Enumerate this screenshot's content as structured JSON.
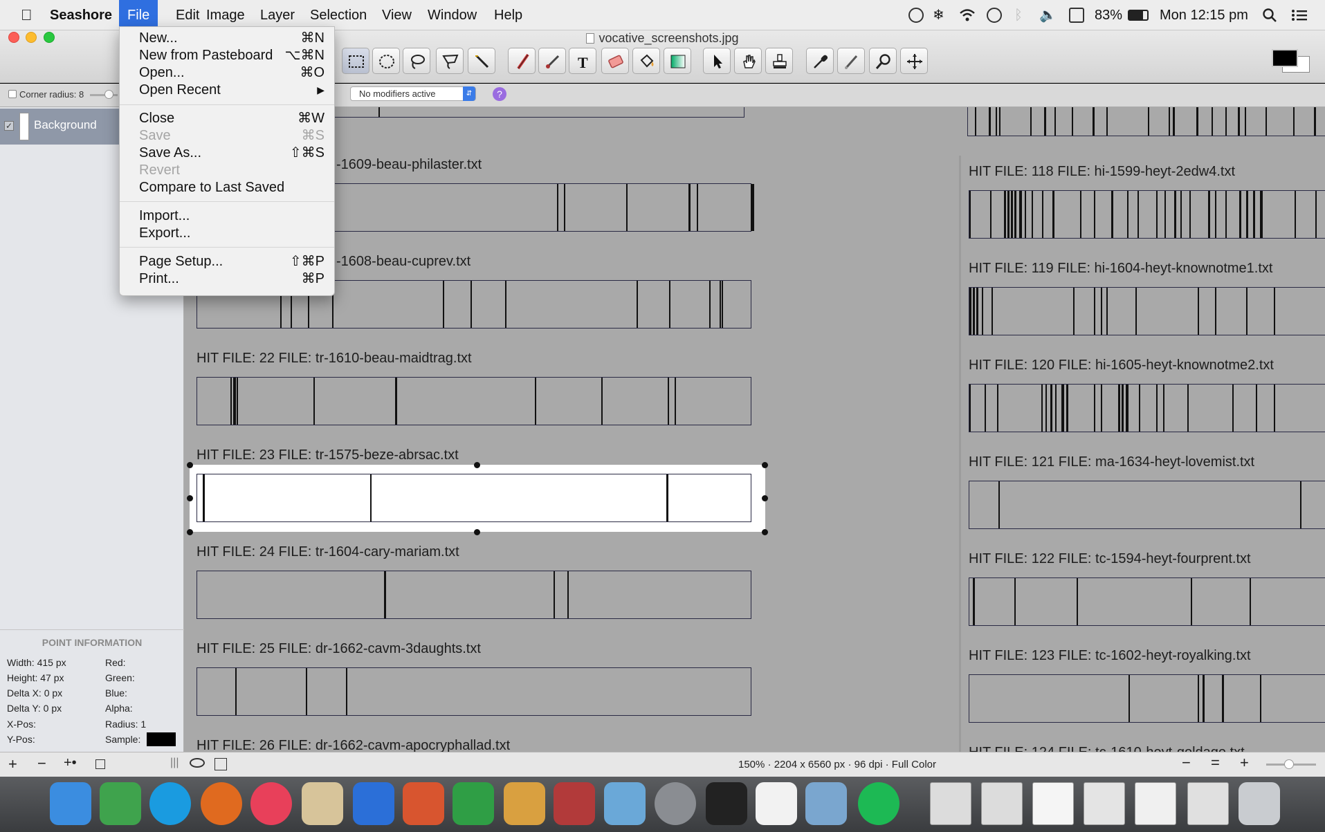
{
  "menubar": {
    "app_name": "Seashore",
    "items": [
      "File",
      "Edit",
      "Image",
      "Layer",
      "Selection",
      "View",
      "Window",
      "Help"
    ],
    "battery": "83%",
    "clock": "Mon 12:15 pm"
  },
  "window": {
    "title": "vocative_screenshots.jpg",
    "tools": [
      "rect-select-icon",
      "ellipse-select-icon",
      "lasso-icon",
      "polygon-lasso-icon",
      "wand-icon",
      "pencil-icon",
      "brush-icon",
      "text-icon",
      "eraser-icon",
      "fill-bucket-icon",
      "gradient-icon",
      "move-pointer-icon",
      "hand-icon",
      "stamp-icon",
      "eyedropper-icon",
      "smudge-icon",
      "zoom-icon",
      "crosshair-icon"
    ],
    "options": {
      "corner_radius_label": "Corner radius: 8",
      "modifier_select": "No modifiers active",
      "help_label": "?"
    }
  },
  "layers": {
    "items": [
      {
        "name": "Background"
      }
    ]
  },
  "file_menu": {
    "items": [
      {
        "label": "New...",
        "shortcut": "⌘N",
        "disabled": false
      },
      {
        "label": "New from Pasteboard",
        "shortcut": "⌥⌘N",
        "disabled": false
      },
      {
        "label": "Open...",
        "shortcut": "⌘O",
        "disabled": false
      },
      {
        "label": "Open Recent",
        "shortcut": "▶",
        "disabled": false
      },
      {
        "label": "Close",
        "shortcut": "⌘W",
        "disabled": false
      },
      {
        "label": "Save",
        "shortcut": "⌘S",
        "disabled": true
      },
      {
        "label": "Save As...",
        "shortcut": "⇧⌘S",
        "disabled": false
      },
      {
        "label": "Revert",
        "shortcut": "",
        "disabled": true
      },
      {
        "label": "Compare to Last Saved",
        "shortcut": "",
        "disabled": false
      },
      {
        "label": "Import...",
        "shortcut": "",
        "disabled": false
      },
      {
        "label": "Export...",
        "shortcut": "",
        "disabled": false
      },
      {
        "label": "Page Setup...",
        "shortcut": "⇧⌘P",
        "disabled": false
      },
      {
        "label": "Print...",
        "shortcut": "⌘P",
        "disabled": false
      }
    ]
  },
  "point_info": {
    "title": "POINT INFORMATION",
    "width": "Width:   415 px",
    "height": "Height:  47 px",
    "delta_x": "Delta X: 0 px",
    "delta_y": "Delta Y: 0 px",
    "x_pos": "X-Pos:",
    "y_pos": "Y-Pos:",
    "red": "Red:",
    "green": "Green:",
    "blue": "Blue:",
    "alpha": "Alpha:",
    "radius": "Radius:   1",
    "sample": "Sample:"
  },
  "canvas": {
    "left_hits": [
      {
        "text": "-1609-beau-philaster.txt"
      },
      {
        "text": "-1608-beau-cuprev.txt"
      },
      {
        "text": "HIT FILE: 22    FILE: tr-1610-beau-maidtrag.txt"
      },
      {
        "text": "HIT FILE: 23    FILE: tr-1575-beze-abrsac.txt"
      },
      {
        "text": "HIT FILE: 24    FILE: tr-1604-cary-mariam.txt"
      },
      {
        "text": "HIT FILE: 25    FILE: dr-1662-cavm-3daughts.txt"
      },
      {
        "text": "HIT FILE: 26    FILE: dr-1662-cavm-apocryphallad.txt"
      }
    ],
    "right_hits": [
      {
        "text": "HIT FILE: 118    FILE: hi-1599-heyt-2edw4.txt"
      },
      {
        "text": "HIT FILE: 119    FILE: hi-1604-heyt-knownotme1.txt"
      },
      {
        "text": "HIT FILE: 120    FILE: hi-1605-heyt-knownotme2.txt"
      },
      {
        "text": "HIT FILE: 121    FILE: ma-1634-heyt-lovemist.txt"
      },
      {
        "text": "HIT FILE: 122    FILE: tc-1594-heyt-fourprent.txt"
      },
      {
        "text": "HIT FILE: 123    FILE: tc-1602-heyt-royalking.txt"
      },
      {
        "text": "HIT FILE: 124    FILE: tc-1610-heyt-goldage.txt"
      }
    ]
  },
  "status": {
    "info": "150% · 2204 x 6560 px · 96 dpi · Full Color"
  },
  "dock": {
    "apps": [
      "finder-icon",
      "adium-icon",
      "skype-icon",
      "firefox-icon",
      "itunes-icon",
      "preview-icon",
      "word-icon",
      "powerpoint-icon",
      "excel-icon",
      "calculator-icon",
      "photo-booth-icon",
      "fish-icon",
      "system-preferences-icon",
      "terminal-icon",
      "textedit-icon",
      "iphoto-icon",
      "spotify-icon",
      "doc-thumb-icon",
      "doc-thumb-icon",
      "doc-thumb-icon",
      "doc-thumb-icon",
      "doc-thumb-icon",
      "doc-thumb-icon",
      "trash-icon"
    ]
  }
}
